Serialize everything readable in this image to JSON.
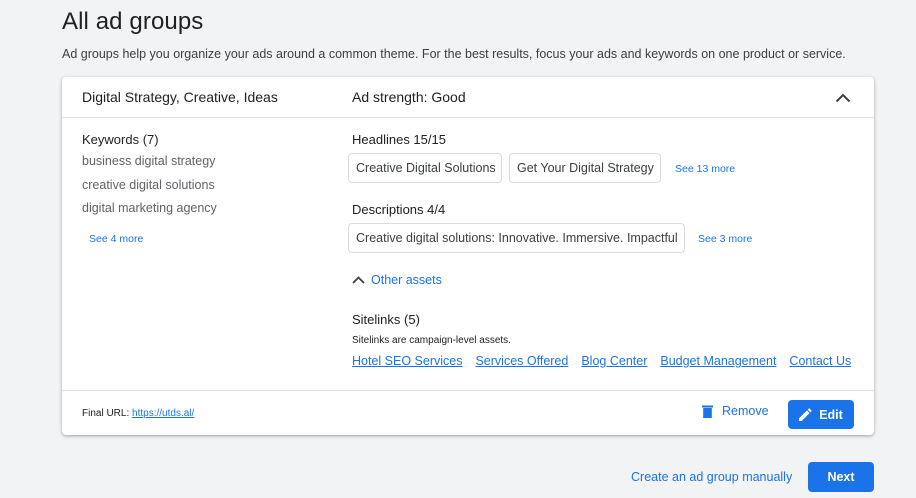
{
  "page": {
    "title": "All ad groups",
    "subtitle": "Ad groups help you organize your ads around a common theme. For the best results, focus your ads and keywords on one product or service."
  },
  "ad_group": {
    "name": "Digital Strategy, Creative, Ideas",
    "ad_strength": "Ad strength: Good",
    "keywords_title": "Keywords (7)",
    "keywords": [
      "business digital strategy",
      "creative digital solutions",
      "digital marketing agency"
    ],
    "keywords_more": "See 4 more",
    "headlines_title": "Headlines 15/15",
    "headlines": [
      "Creative Digital Solutions",
      "Get Your Digital Strategy"
    ],
    "headlines_more": "See 13 more",
    "descriptions_title": "Descriptions 4/4",
    "descriptions": [
      "Creative digital solutions: Innovative. Immersive. Impactful"
    ],
    "descriptions_more": "See 3 more",
    "other_assets_label": "Other assets",
    "sitelinks_title": "Sitelinks (5)",
    "sitelinks_note": "Sitelinks are campaign-level assets.",
    "sitelinks": [
      "Hotel SEO Services",
      "Services Offered",
      "Blog Center",
      "Budget Management",
      "Contact Us"
    ],
    "final_url_label": "Final URL:",
    "final_url": "https://utds.al/",
    "remove_label": "Remove",
    "edit_label": "Edit"
  },
  "footer": {
    "create_manually": "Create an ad group manually",
    "next_label": "Next"
  },
  "icons": {
    "collapse": "chevron-up-icon",
    "other_assets": "chevron-up-icon",
    "remove": "trash-icon",
    "edit": "pencil-icon"
  },
  "colors": {
    "accent": "#1a73e8",
    "background": "#f1f3f4",
    "card": "#ffffff",
    "border": "#dadce0"
  }
}
